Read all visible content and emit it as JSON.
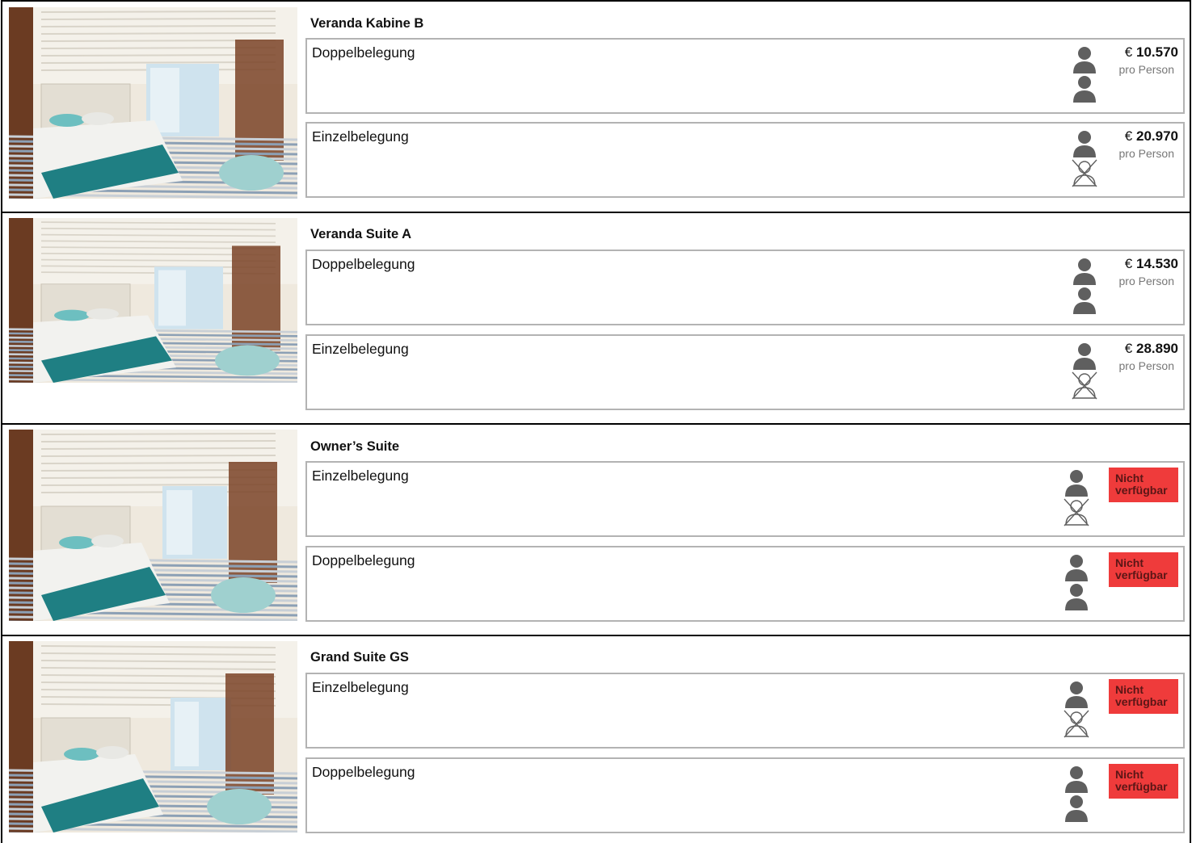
{
  "cabins": [
    {
      "title": "Veranda Kabine B",
      "options": [
        {
          "label": "Doppelbelegung",
          "persons": "double",
          "currency": "€",
          "amount": "10.570",
          "unit": "pro Person"
        },
        {
          "label": "Einzelbelegung",
          "persons": "single",
          "currency": "€",
          "amount": "20.970",
          "unit": "pro Person"
        }
      ]
    },
    {
      "title": "Veranda Suite A",
      "options": [
        {
          "label": "Doppelbelegung",
          "persons": "double",
          "currency": "€",
          "amount": "14.530",
          "unit": "pro Person"
        },
        {
          "label": "Einzelbelegung",
          "persons": "single",
          "currency": "€",
          "amount": "28.890",
          "unit": "pro Person"
        }
      ]
    },
    {
      "title": "Owner’s Suite",
      "options": [
        {
          "label": "Einzelbelegung",
          "persons": "single",
          "status": "Nicht verfügbar"
        },
        {
          "label": "Doppelbelegung",
          "persons": "double",
          "status": "Nicht verfügbar"
        }
      ]
    },
    {
      "title": "Grand Suite GS",
      "options": [
        {
          "label": "Einzelbelegung",
          "persons": "single",
          "status": "Nicht verfügbar"
        },
        {
          "label": "Doppelbelegung",
          "persons": "double",
          "status": "Nicht verfügbar"
        }
      ]
    }
  ],
  "colors": {
    "unavailable": "#ef3b3b",
    "person_icon": "#5f5f5f",
    "option_border": "#b3b3b3"
  },
  "icons": [
    "cabin-photo",
    "person-icon",
    "person-crossed-icon"
  ]
}
